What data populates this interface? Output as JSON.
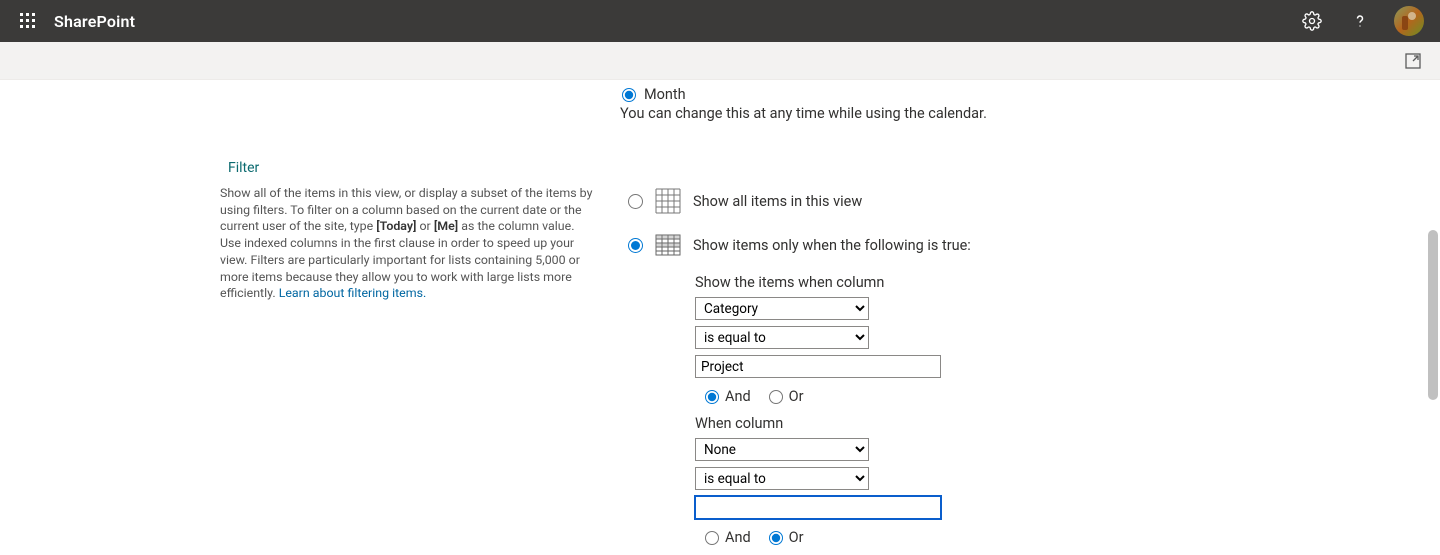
{
  "header": {
    "brand": "SharePoint"
  },
  "calendar_fragment": {
    "month_label": "Month",
    "note": "You can change this at any time while using the calendar."
  },
  "filter_section": {
    "title": "Filter",
    "help_pre": "Show all of the items in this view, or display a subset of the items by using filters. To filter on a column based on the current date or the current user of the site, type ",
    "help_today": "[Today]",
    "help_or": " or ",
    "help_me": "[Me]",
    "help_mid": " as the column value. Use indexed columns in the first clause in order to speed up your view. Filters are particularly important for lists containing 5,000 or more items because they allow you to work with large lists more efficiently. ",
    "help_link": "Learn about filtering items.",
    "option_all_label": "Show all items in this view",
    "option_when_label": "Show items only when the following is true:",
    "clause1": {
      "header": "Show the items when column",
      "column_value": "Category",
      "operator_value": "is equal to",
      "value_text": "Project",
      "conn_and": "And",
      "conn_or": "Or"
    },
    "clause2": {
      "header": "When column",
      "column_value": "None",
      "operator_value": "is equal to",
      "value_text": "",
      "conn_and": "And",
      "conn_or": "Or"
    }
  }
}
